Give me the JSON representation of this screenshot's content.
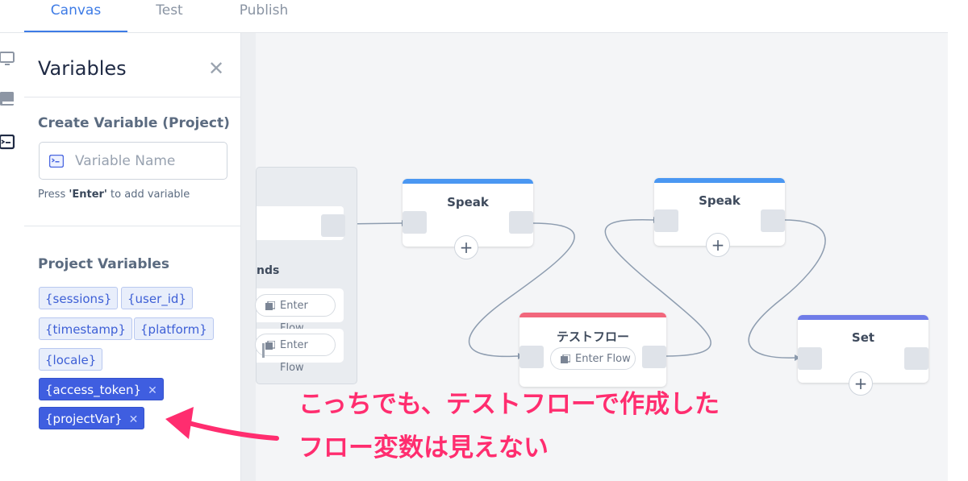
{
  "tabs": [
    {
      "label": "Canvas",
      "active": true
    },
    {
      "label": "Test",
      "active": false
    },
    {
      "label": "Publish",
      "active": false
    }
  ],
  "rail": {
    "icons": [
      "monitor-icon",
      "book-icon",
      "terminal-icon"
    ]
  },
  "panel": {
    "title": "Variables",
    "close_icon": "close-icon",
    "create_section_title": "Create Variable (Project)",
    "input_placeholder": "Variable Name",
    "hint_prefix": "Press ",
    "hint_key": "'Enter'",
    "hint_suffix": " to add variable",
    "project_section_title": "Project Variables",
    "variables": [
      {
        "name": "{sessions}",
        "removable": false
      },
      {
        "name": "{user_id}",
        "removable": false
      },
      {
        "name": "{timestamp}",
        "removable": false
      },
      {
        "name": "{platform}",
        "removable": false
      },
      {
        "name": "{locale}",
        "removable": false
      },
      {
        "name": "{access_token}",
        "removable": true
      },
      {
        "name": "{projectVar}",
        "removable": true
      }
    ],
    "remove_glyph": "✕"
  },
  "canvas": {
    "partial_block": {
      "label_fragment": "nds",
      "buttons": [
        "Enter Flow",
        "Enter Flow"
      ]
    },
    "nodes": {
      "speak1": {
        "title": "Speak",
        "accent": "#4a97f2"
      },
      "speak2": {
        "title": "Speak",
        "accent": "#4a97f2"
      },
      "flow": {
        "title": "テストフロー",
        "button": "Enter Flow",
        "accent": "#f2677c"
      },
      "set": {
        "title": "Set",
        "accent": "#6f7ce8"
      }
    },
    "plus_glyph": "+"
  },
  "annotation": {
    "line1": "こっちでも、テストフローで作成した",
    "line2": "フロー変数は見えない",
    "color": "#ff2d6f"
  },
  "colors": {
    "accent": "#3d7be6",
    "chip_light": "#e8eefb",
    "chip_dark": "#3f5ee0"
  }
}
